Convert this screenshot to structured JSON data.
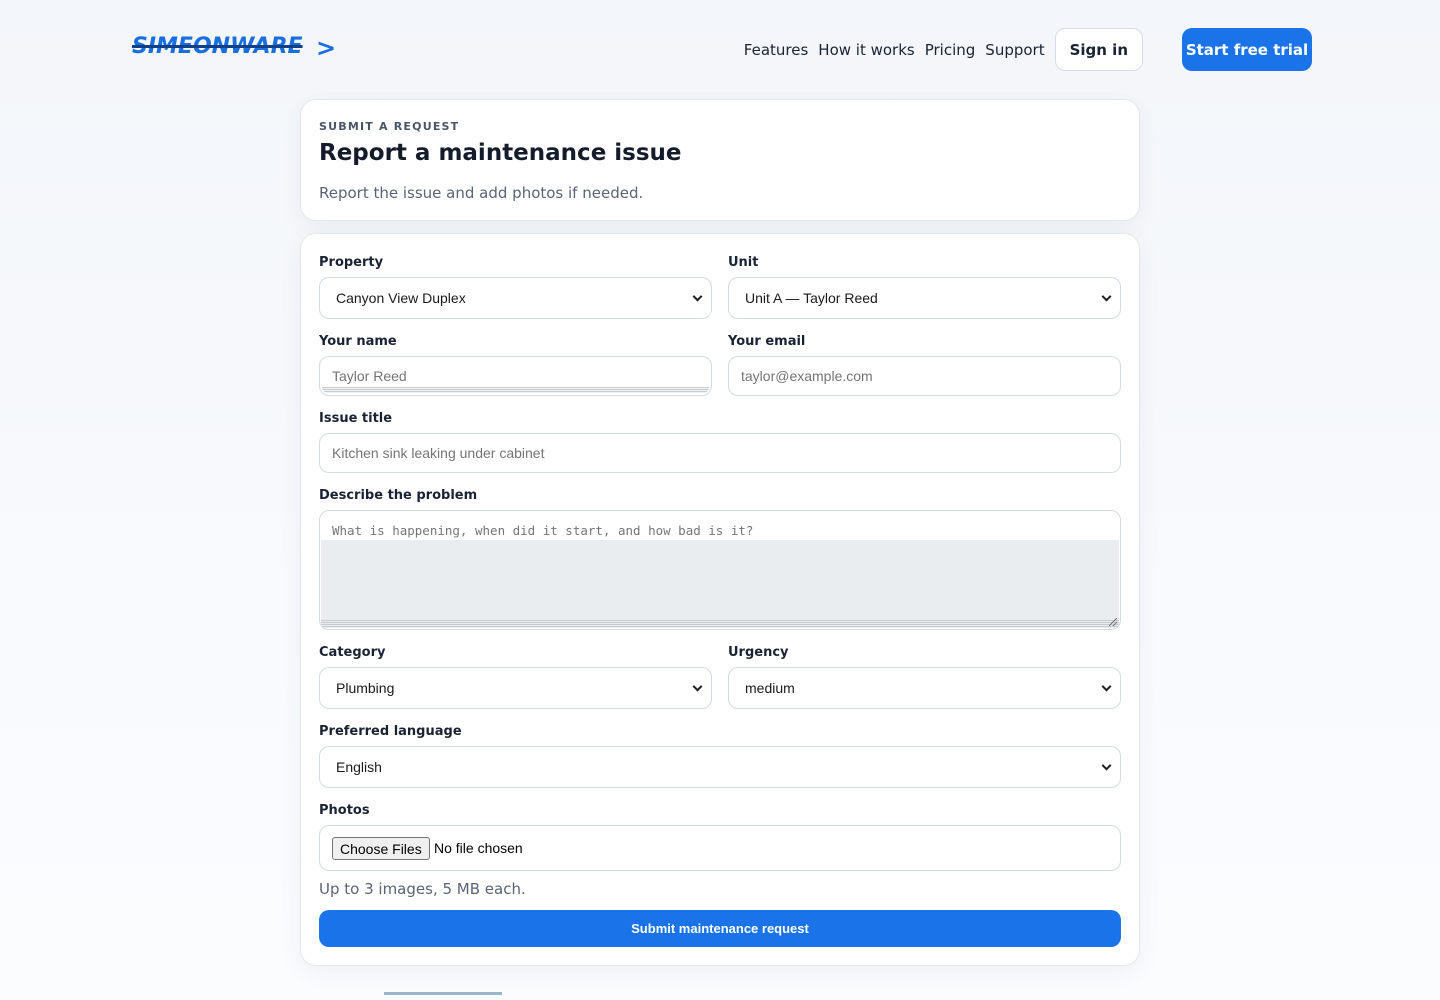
{
  "header": {
    "logo": "SIMEONWARE",
    "logo_arrow": ">",
    "nav": [
      "Features",
      "How it works",
      "Pricing",
      "Support"
    ],
    "sign_in": "Sign in",
    "trial": "Start free trial"
  },
  "intro": {
    "eyebrow": "SUBMIT A REQUEST",
    "title": "Report a maintenance issue",
    "subtitle": "Report the issue and add photos if needed."
  },
  "form": {
    "property": {
      "label": "Property",
      "value": "Canyon View Duplex"
    },
    "unit": {
      "label": "Unit",
      "value": "Unit A — Taylor Reed"
    },
    "name": {
      "label": "Your name",
      "placeholder": "Taylor Reed"
    },
    "email": {
      "label": "Your email",
      "placeholder": "taylor@example.com"
    },
    "issue_title": {
      "label": "Issue title",
      "placeholder": "Kitchen sink leaking under cabinet"
    },
    "description": {
      "label": "Describe the problem",
      "placeholder": "What is happening, when did it start, and how bad is it?"
    },
    "category": {
      "label": "Category",
      "value": "Plumbing"
    },
    "urgency": {
      "label": "Urgency",
      "value": "medium"
    },
    "language": {
      "label": "Preferred language",
      "value": "English"
    },
    "photos": {
      "label": "Photos",
      "button": "Choose Files",
      "status": "No file chosen",
      "hint": "Up to 3 images, 5 MB each."
    },
    "submit": "Submit maintenance request"
  },
  "colors": {
    "accent": "#1a73e8",
    "text": "#1a2333",
    "muted": "#5a6474"
  },
  "icons": {
    "select_arrow": "chevron-down-icon",
    "resize_handle": "resize-grip-icon"
  }
}
